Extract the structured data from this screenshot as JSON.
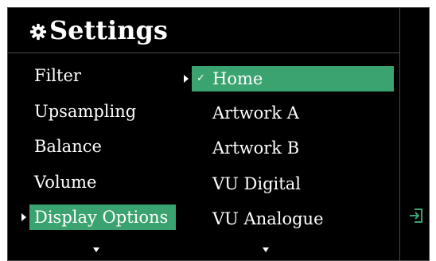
{
  "header": {
    "title": "Settings",
    "icon": "gear-icon"
  },
  "menu": {
    "items": [
      {
        "label": "Filter"
      },
      {
        "label": "Upsampling"
      },
      {
        "label": "Balance"
      },
      {
        "label": "Volume"
      },
      {
        "label": "Display Options",
        "selected": true
      }
    ]
  },
  "submenu": {
    "items": [
      {
        "label": "Home",
        "selected": true,
        "checked": true,
        "check_mark": "✓"
      },
      {
        "label": "Artwork A"
      },
      {
        "label": "Artwork B"
      },
      {
        "label": "VU Digital"
      },
      {
        "label": "VU Analogue"
      }
    ]
  },
  "side": {
    "icon": "exit-icon"
  },
  "colors": {
    "accent": "#3aa36f",
    "background": "#000000",
    "text": "#ffffff",
    "divider": "#4a4a4a"
  }
}
